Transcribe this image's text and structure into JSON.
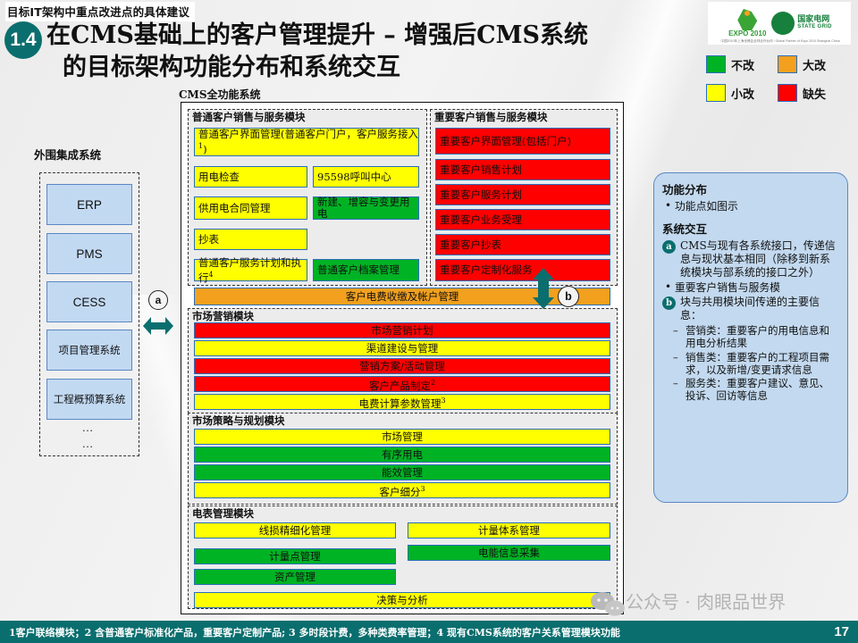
{
  "header": {
    "kicker": "目标IT架构中重点改进点的具体建议",
    "badge": "1.4",
    "title_line1": "在CMS基础上的客户管理提升 – 增强后CMS系统",
    "title_line2": "的目标架构功能分布和系统交互",
    "logo_expo_text": "EXPO 2010",
    "logo_sg_cn": "国家电网",
    "logo_sg_en": "STATE GRID",
    "logo_sg_sub": "中国2010年上海世博会全球合作伙伴 / Global Partner of Expo 2010 Shanghai China"
  },
  "legend": {
    "items": [
      {
        "label": "不改",
        "color": "#00b324"
      },
      {
        "label": "大改",
        "color": "#f2a01e"
      },
      {
        "label": "小改",
        "color": "#ffff00"
      },
      {
        "label": "缺失",
        "color": "#ff0000"
      }
    ]
  },
  "external": {
    "title": "外围集成系统",
    "items": [
      "ERP",
      "PMS",
      "CESS",
      "项目管理系统",
      "工程概预算系统"
    ],
    "dots1": "…",
    "dots2": "…"
  },
  "markers": {
    "a": "a",
    "b": "b"
  },
  "cms": {
    "label": "CMS全功能系统",
    "module_normal": {
      "title": "普通客户销售与服务模块",
      "cells": [
        {
          "text": "普通客户界面管理(普通客户门户，客户服务接入1)",
          "color": "小改"
        },
        {
          "text": "用电检查",
          "color": "小改"
        },
        {
          "text": "95598呼叫中心",
          "color": "小改"
        },
        {
          "text": "供用电合同管理",
          "color": "小改"
        },
        {
          "text": "新建、增容与变更用电",
          "color": "不改"
        },
        {
          "text": "抄表",
          "color": "小改"
        },
        {
          "text": "普通客户服务计划和执行4",
          "color": "小改"
        },
        {
          "text": "普通客户档案管理",
          "color": "不改"
        }
      ]
    },
    "module_key": {
      "title": "重要客户销售与服务模块",
      "cells": [
        {
          "text": "重要客户界面管理(包括门户)",
          "color": "缺失"
        },
        {
          "text": "重要客户销售计划",
          "color": "缺失"
        },
        {
          "text": "重要客户服务计划",
          "color": "缺失"
        },
        {
          "text": "重要客户业务受理",
          "color": "缺失"
        },
        {
          "text": "重要客户抄表",
          "color": "缺失"
        },
        {
          "text": "重要客户定制化服务",
          "color": "缺失"
        }
      ]
    },
    "shared_bar": {
      "text": "客户电费收缴及帐户管理",
      "color": "大改"
    },
    "module_marketing": {
      "title": "市场营销模块",
      "cells": [
        {
          "text": "市场营销计划",
          "color": "缺失"
        },
        {
          "text": "渠道建设与管理",
          "color": "小改"
        },
        {
          "text": "营销方案/活动管理",
          "color": "缺失"
        },
        {
          "text": "客户产品制定2",
          "color": "缺失"
        },
        {
          "text": "电费计算参数管理3",
          "color": "小改"
        }
      ]
    },
    "module_strategy": {
      "title": "市场策略与规划模块",
      "cells": [
        {
          "text": "市场管理",
          "color": "小改"
        },
        {
          "text": "有序用电",
          "color": "不改"
        },
        {
          "text": "能效管理",
          "color": "不改"
        },
        {
          "text": "客户细分3",
          "color": "小改"
        }
      ]
    },
    "module_meter": {
      "title": "电表管理模块",
      "cells": [
        {
          "text": "线损精细化管理",
          "color": "小改"
        },
        {
          "text": "计量体系管理",
          "color": "小改"
        },
        {
          "text": "计量点管理",
          "color": "不改"
        },
        {
          "text": "电能信息采集",
          "color": "不改"
        },
        {
          "text": "资产管理",
          "color": "不改"
        }
      ]
    },
    "decision_bar": {
      "text": "决策与分析",
      "color": "小改"
    }
  },
  "info": {
    "heading1": "功能分布",
    "bullet1": "功能点如图示",
    "heading2": "系统交互",
    "item_a": "CMS与现有各系统接口，传递信息与现状基本相同（除移到新系统模块与部系统的接口之外）",
    "bullet2": "重要客户销售与服务模",
    "item_b": "块与共用模块间传递的主要信息：",
    "dash1": "营销类：重要客户的用电信息和用电分析结果",
    "dash2": "销售类：重要客户的工程项目需求，以及新增/变更请求信息",
    "dash3": "服务类：重要客户建议、意见、投诉、回访等信息"
  },
  "watermark": "公众号 · 肉眼品世界",
  "footer": {
    "note": "1客户联络模块；2 含普通客户标准化产品，重要客户定制产品; 3 多时段计费，多种类费率管理；4 现有CMS系统的客户关系管理模块功能",
    "page": "17"
  }
}
